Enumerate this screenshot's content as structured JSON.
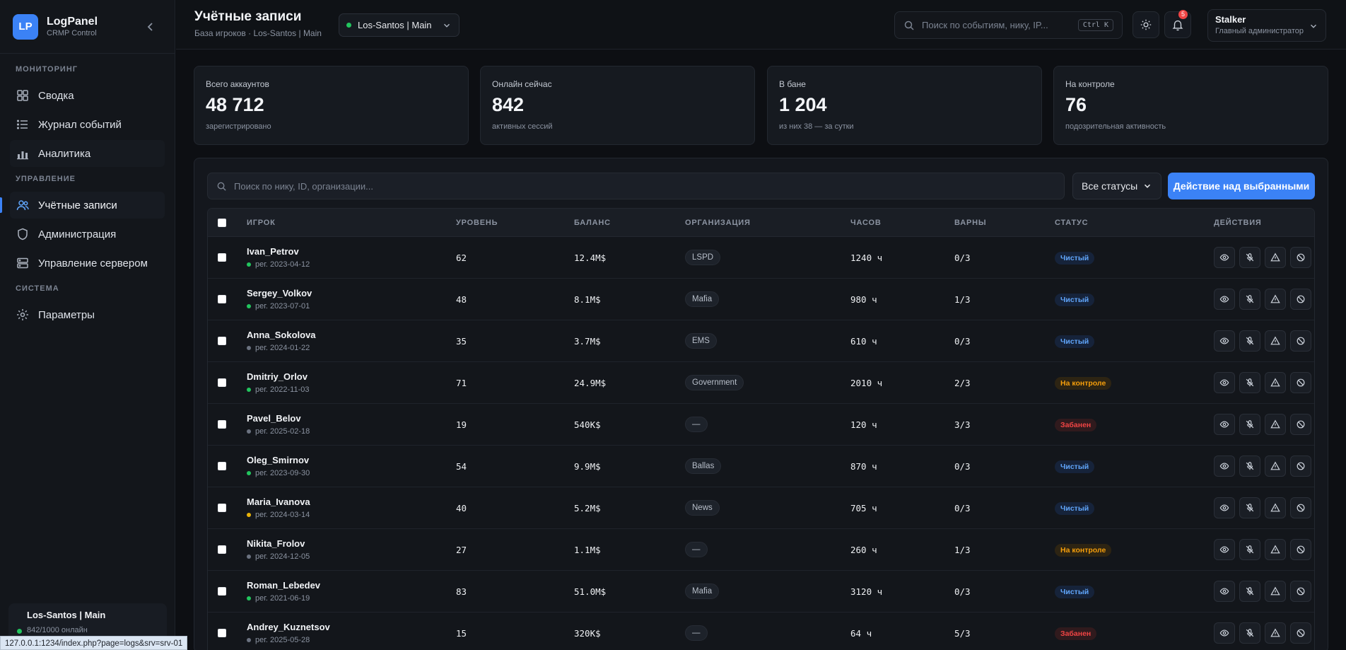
{
  "brand": {
    "logo": "LP",
    "title": "LogPanel",
    "subtitle": "CRMP Control"
  },
  "nav": {
    "sections": [
      {
        "label": "МОНИТОРИНГ",
        "items": [
          {
            "label": "Сводка",
            "icon": "grid-icon"
          },
          {
            "label": "Журнал событий",
            "icon": "list-icon"
          },
          {
            "label": "Аналитика",
            "icon": "bar-chart-icon"
          }
        ]
      },
      {
        "label": "УПРАВЛЕНИЕ",
        "items": [
          {
            "label": "Учётные записи",
            "icon": "users-icon"
          },
          {
            "label": "Администрация",
            "icon": "shield-icon"
          },
          {
            "label": "Управление сервером",
            "icon": "server-icon"
          }
        ]
      },
      {
        "label": "СИСТЕМА",
        "items": [
          {
            "label": "Параметры",
            "icon": "gear-icon"
          }
        ]
      }
    ]
  },
  "server_card": {
    "name": "Los-Santos | Main",
    "online": "842/1000 онлайн"
  },
  "status_url": "127.0.0.1:1234/index.php?page=logs&srv=srv-01",
  "header": {
    "title": "Учётные записи",
    "subtitle": "База игроков · Los-Santos | Main",
    "server_select": "Los-Santos | Main",
    "search_placeholder": "Поиск по событиям, нику, IP...",
    "search_shortcut": "Ctrl K",
    "notifications_count": "5",
    "user_name": "Stalker",
    "user_role": "Главный администратор"
  },
  "stats": [
    {
      "label": "Всего аккаунтов",
      "value": "48 712",
      "note": "зарегистрировано"
    },
    {
      "label": "Онлайн сейчас",
      "value": "842",
      "note": "активных сессий"
    },
    {
      "label": "В бане",
      "value": "1 204",
      "note": "из них 38 — за сутки"
    },
    {
      "label": "На контроле",
      "value": "76",
      "note": "подозрительная активность"
    }
  ],
  "filters": {
    "search_placeholder": "Поиск по нику, ID, организации...",
    "status_select": "Все статусы",
    "bulk_action": "Действие над выбранными"
  },
  "table": {
    "columns": [
      "ИГРОК",
      "УРОВЕНЬ",
      "БАЛАНС",
      "ОРГАНИЗАЦИЯ",
      "ЧАСОВ",
      "ВАРНЫ",
      "СТАТУС",
      "ДЕЙСТВИЯ"
    ],
    "rows": [
      {
        "name": "Ivan_Petrov",
        "reg": "рег. 2023-04-12",
        "presence": "#22c55e",
        "level": "62",
        "balance": "12.4M$",
        "org": "LSPD",
        "hours": "1240 ч",
        "warns": "0/3",
        "status": "Чистый",
        "status_kind": "clean"
      },
      {
        "name": "Sergey_Volkov",
        "reg": "рег. 2023-07-01",
        "presence": "#22c55e",
        "level": "48",
        "balance": "8.1M$",
        "org": "Mafia",
        "hours": "980 ч",
        "warns": "1/3",
        "status": "Чистый",
        "status_kind": "clean"
      },
      {
        "name": "Anna_Sokolova",
        "reg": "рег. 2024-01-22",
        "presence": "#6b7280",
        "level": "35",
        "balance": "3.7M$",
        "org": "EMS",
        "hours": "610 ч",
        "warns": "0/3",
        "status": "Чистый",
        "status_kind": "clean"
      },
      {
        "name": "Dmitriy_Orlov",
        "reg": "рег. 2022-11-03",
        "presence": "#22c55e",
        "level": "71",
        "balance": "24.9M$",
        "org": "Government",
        "hours": "2010 ч",
        "warns": "2/3",
        "status": "На контроле",
        "status_kind": "watch"
      },
      {
        "name": "Pavel_Belov",
        "reg": "рег. 2025-02-18",
        "presence": "#6b7280",
        "level": "19",
        "balance": "540K$",
        "org": "—",
        "hours": "120 ч",
        "warns": "3/3",
        "status": "Забанен",
        "status_kind": "ban"
      },
      {
        "name": "Oleg_Smirnov",
        "reg": "рег. 2023-09-30",
        "presence": "#22c55e",
        "level": "54",
        "balance": "9.9M$",
        "org": "Ballas",
        "hours": "870 ч",
        "warns": "0/3",
        "status": "Чистый",
        "status_kind": "clean"
      },
      {
        "name": "Maria_Ivanova",
        "reg": "рег. 2024-03-14",
        "presence": "#eab308",
        "level": "40",
        "balance": "5.2M$",
        "org": "News",
        "hours": "705 ч",
        "warns": "0/3",
        "status": "Чистый",
        "status_kind": "clean"
      },
      {
        "name": "Nikita_Frolov",
        "reg": "рег. 2024-12-05",
        "presence": "#6b7280",
        "level": "27",
        "balance": "1.1M$",
        "org": "—",
        "hours": "260 ч",
        "warns": "1/3",
        "status": "На контроле",
        "status_kind": "watch"
      },
      {
        "name": "Roman_Lebedev",
        "reg": "рег. 2021-06-19",
        "presence": "#22c55e",
        "level": "83",
        "balance": "51.0M$",
        "org": "Mafia",
        "hours": "3120 ч",
        "warns": "0/3",
        "status": "Чистый",
        "status_kind": "clean"
      },
      {
        "name": "Andrey_Kuznetsov",
        "reg": "рег. 2025-05-28",
        "presence": "#6b7280",
        "level": "15",
        "balance": "320K$",
        "org": "—",
        "hours": "64 ч",
        "warns": "5/3",
        "status": "Забанен",
        "status_kind": "ban"
      }
    ],
    "row_actions": [
      "eye-icon",
      "mute-icon",
      "warning-icon",
      "ban-icon"
    ]
  },
  "colors": {
    "accent": "#3b82f6",
    "online": "#22c55e",
    "warning": "#f59e0b",
    "danger": "#ef4444"
  }
}
